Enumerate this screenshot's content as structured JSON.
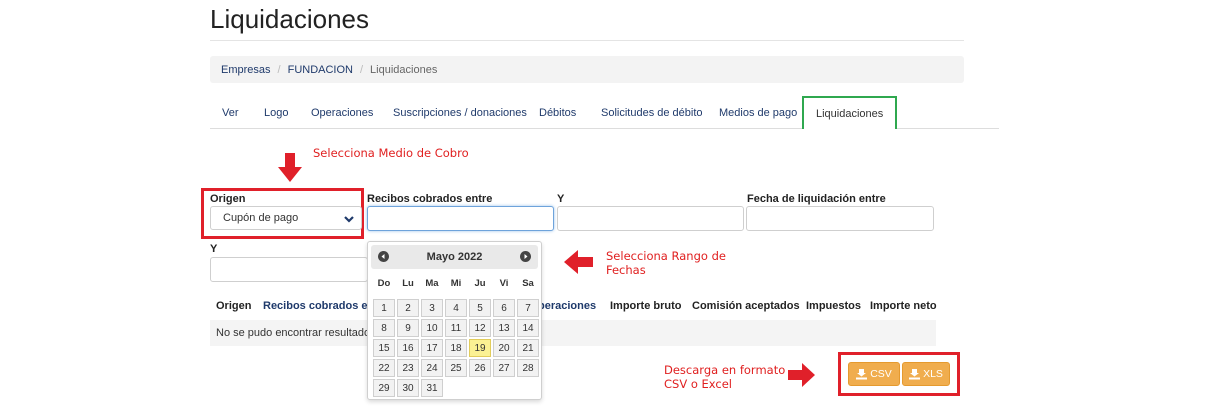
{
  "page_title": "Liquidaciones",
  "breadcrumb": [
    {
      "label": "Empresas",
      "active": false
    },
    {
      "label": "FUNDACION",
      "active": false
    },
    {
      "label": "Liquidaciones",
      "active": true
    }
  ],
  "tabs": [
    {
      "label": "Ver"
    },
    {
      "label": "Logo"
    },
    {
      "label": "Operaciones"
    },
    {
      "label": "Suscripciones / donaciones"
    },
    {
      "label": "Débitos"
    },
    {
      "label": "Solicitudes de débito"
    },
    {
      "label": "Medios de pago"
    },
    {
      "label": "Liquidaciones",
      "active": true
    }
  ],
  "annotations": {
    "medio_cobro": "Selecciona Medio de Cobro",
    "rango_fechas": [
      "Selecciona Rango de",
      "Fechas"
    ],
    "descarga": [
      "Descarga en formato",
      "CSV o Excel"
    ]
  },
  "filters": {
    "origen_label": "Origen",
    "origen_value": "Cupón de pago",
    "recibos_label": "Recibos cobrados entre",
    "y_label": "Y",
    "fecha_liq_label": "Fecha de liquidación entre",
    "y2_label": "Y"
  },
  "datepicker": {
    "month_label": "Mayo 2022",
    "weekdays": [
      "Do",
      "Lu",
      "Ma",
      "Mi",
      "Ju",
      "Vi",
      "Sa"
    ],
    "today": "19",
    "weeks": [
      [
        "",
        "",
        "",
        "",
        "",
        "",
        ""
      ],
      [
        "1",
        "2",
        "3",
        "4",
        "5",
        "6",
        "7"
      ],
      [
        "8",
        "9",
        "10",
        "11",
        "12",
        "13",
        "14"
      ],
      [
        "15",
        "16",
        "17",
        "18",
        "19",
        "20",
        "21"
      ],
      [
        "22",
        "23",
        "24",
        "25",
        "26",
        "27",
        "28"
      ],
      [
        "29",
        "30",
        "31",
        "",
        "",
        "",
        ""
      ]
    ]
  },
  "table": {
    "headers": [
      {
        "label": "Origen",
        "link": false
      },
      {
        "label": "Recibos cobrados el",
        "link": true
      },
      {
        "label": "Operaciones",
        "link": true,
        "visible_text": "peraciones"
      },
      {
        "label": "Importe bruto",
        "link": false
      },
      {
        "label": "Comisión aceptados",
        "link": false
      },
      {
        "label": "Impuestos",
        "link": false
      },
      {
        "label": "Importe neto",
        "link": false
      }
    ],
    "empty_message": "No se pudo encontrar resultados p"
  },
  "downloads": {
    "csv_label": "CSV",
    "xls_label": "XLS"
  },
  "colors": {
    "link": "#1f3a6b",
    "active_tab_border": "#2fa84f",
    "annotation_red": "#e0202a",
    "button_orange": "#f0ad4e",
    "today_yellow": "#fbf193"
  }
}
